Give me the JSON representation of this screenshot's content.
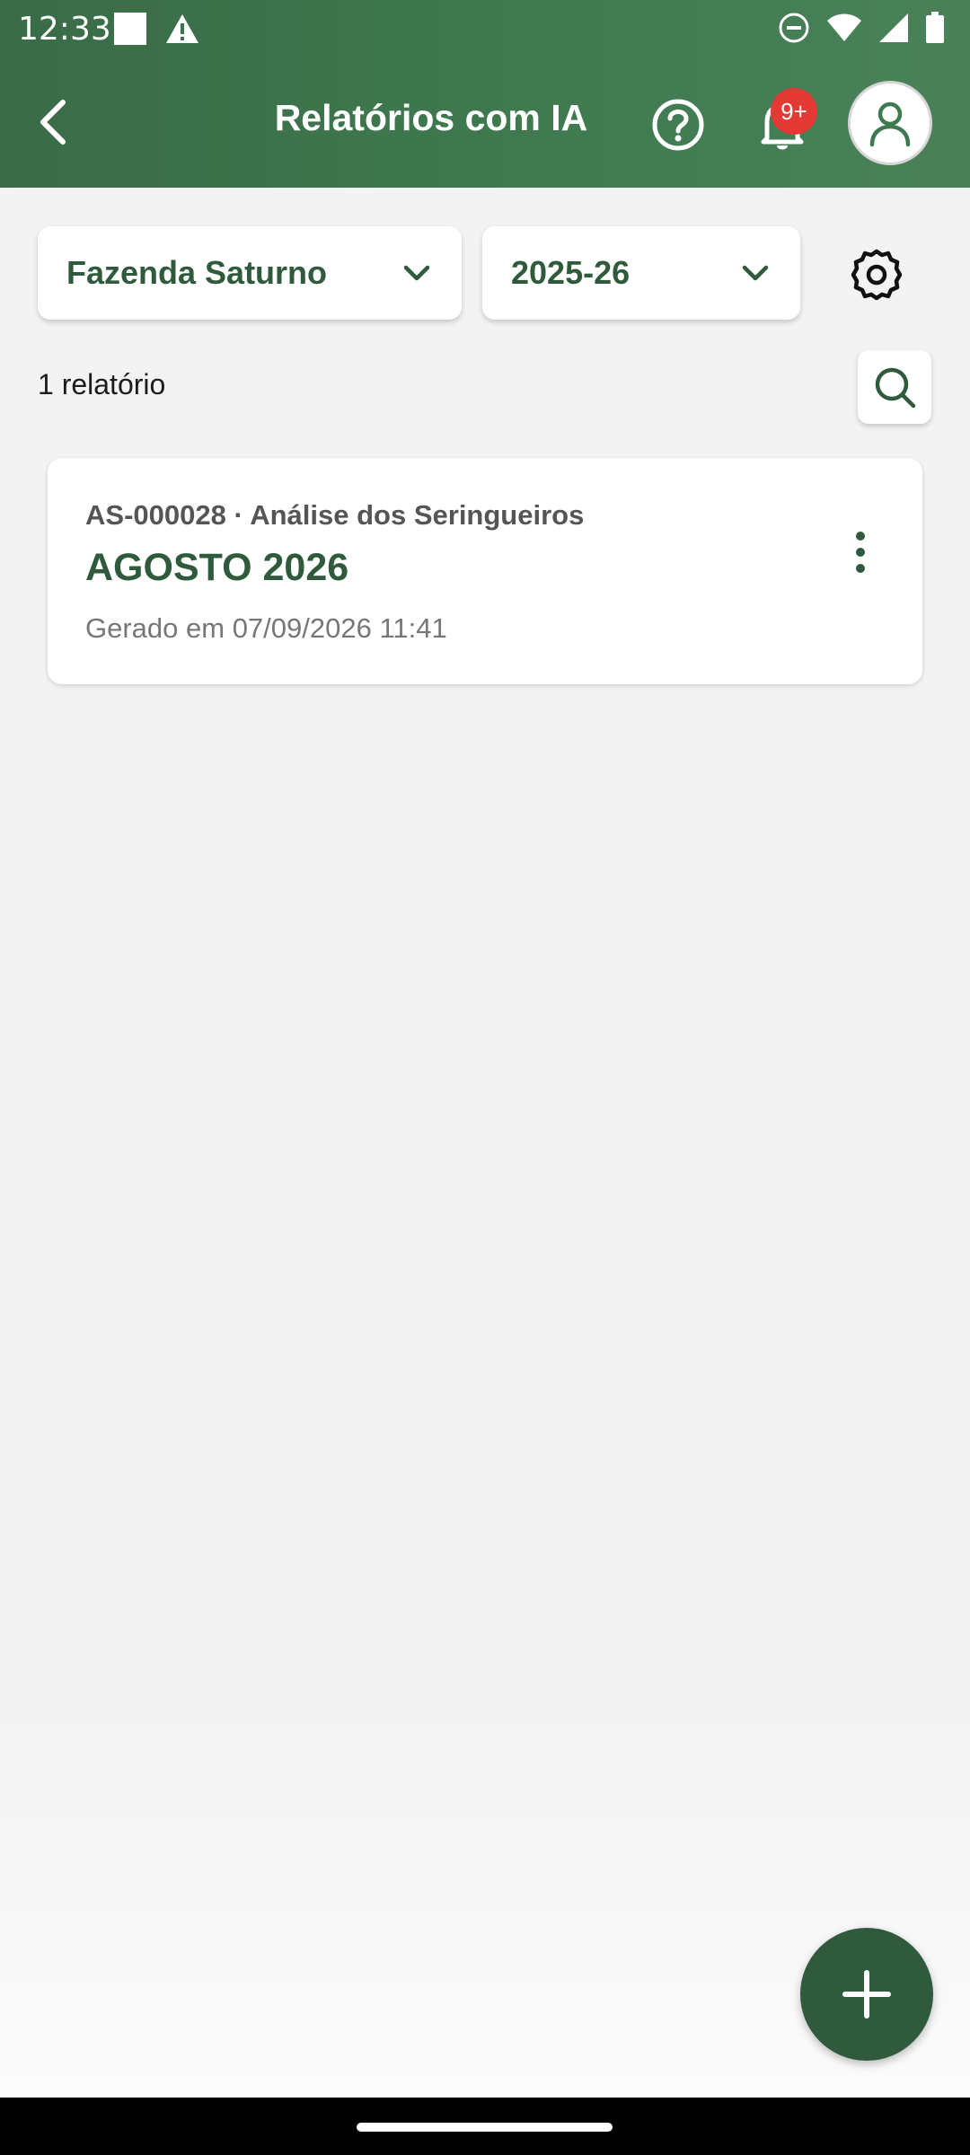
{
  "status_bar": {
    "time": "12:33",
    "left_icons": [
      "notification-square-icon",
      "warning-icon"
    ],
    "right_icons": [
      "do-not-disturb-icon",
      "wifi-icon",
      "signal-icon",
      "battery-icon"
    ]
  },
  "app_bar": {
    "title": "Relatórios com IA",
    "notification_badge": "9+",
    "background_color": "#3f7a4f"
  },
  "filters": {
    "farm": "Fazenda Saturno",
    "season": "2025-26"
  },
  "results": {
    "count_label": "1 relatório"
  },
  "reports": [
    {
      "meta": "AS-000028 · Análise dos Seringueiros",
      "title": "AGOSTO 2026",
      "generated": "Gerado em 07/09/2026 11:41"
    }
  ],
  "colors": {
    "accent": "#2f5a3c",
    "badge": "#e53935"
  }
}
